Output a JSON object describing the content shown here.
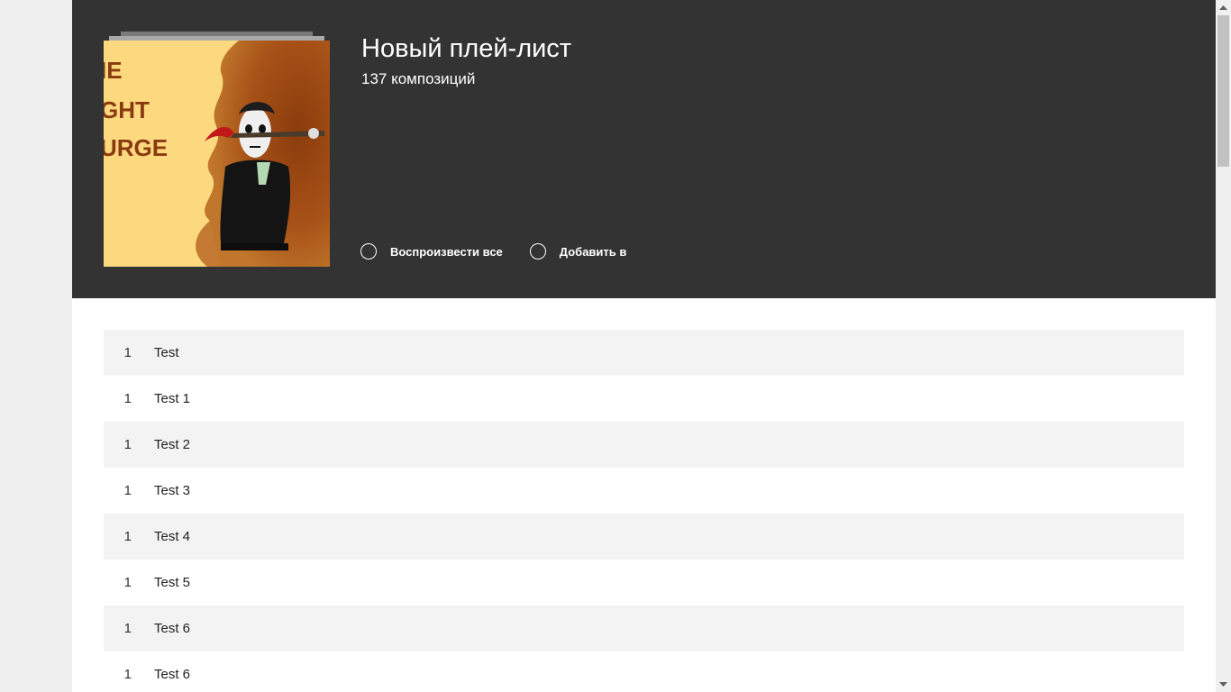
{
  "playlist": {
    "title": "Новый плей-лист",
    "count_label": "137 композиций",
    "cover_text_lines": [
      "IE",
      "GHT",
      "URGE"
    ]
  },
  "actions": {
    "play_all": "Воспроизвести все",
    "add_to": "Добавить в"
  },
  "tracks": [
    {
      "number": "1",
      "title": "Test"
    },
    {
      "number": "1",
      "title": "Test 1"
    },
    {
      "number": "1",
      "title": "Test 2"
    },
    {
      "number": "1",
      "title": "Test 3"
    },
    {
      "number": "1",
      "title": "Test 4"
    },
    {
      "number": "1",
      "title": "Test 5"
    },
    {
      "number": "1",
      "title": "Test 6"
    },
    {
      "number": "1",
      "title": "Test 6"
    }
  ],
  "colors": {
    "header_bg": "#333333",
    "row_alt_bg": "#f3f3f3",
    "page_bg": "#ffffff",
    "side_bg": "#efefef"
  }
}
